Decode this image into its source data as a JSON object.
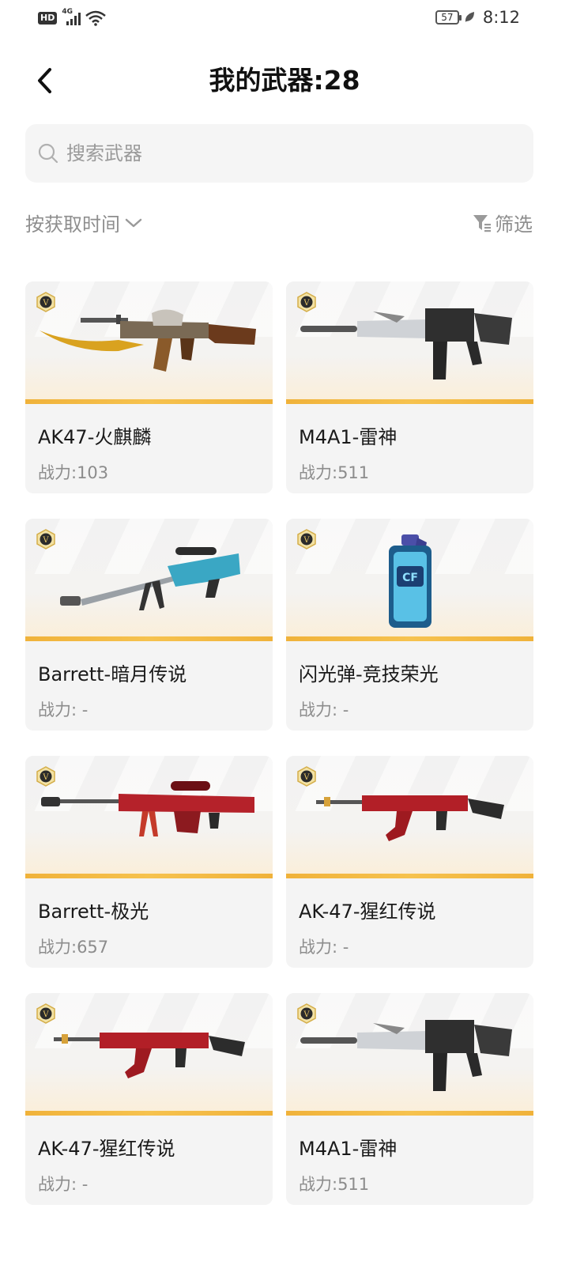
{
  "status_bar": {
    "hd": "HD",
    "network": "4G",
    "battery": "57",
    "time": "8:12"
  },
  "header": {
    "title": "我的武器:28"
  },
  "search": {
    "placeholder": "搜索武器"
  },
  "toolbar": {
    "sort_label": "按获取时间",
    "filter_label": "筛选"
  },
  "weapons": [
    {
      "name": "AK47-火麒麟",
      "power": "战力:103",
      "icon": "rifle-gold"
    },
    {
      "name": "M4A1-雷神",
      "power": "战力:511",
      "icon": "m4-silver"
    },
    {
      "name": "Barrett-暗月传说",
      "power": "战力: -",
      "icon": "sniper-cyan"
    },
    {
      "name": "闪光弹-竞技荣光",
      "power": "战力: -",
      "icon": "flashbang-blue"
    },
    {
      "name": "Barrett-极光",
      "power": "战力:657",
      "icon": "sniper-red"
    },
    {
      "name": "AK-47-猩红传说",
      "power": "战力: -",
      "icon": "rifle-red"
    },
    {
      "name": "AK-47-猩红传说",
      "power": "战力: -",
      "icon": "rifle-red"
    },
    {
      "name": "M4A1-雷神",
      "power": "战力:511",
      "icon": "m4-silver"
    }
  ],
  "colors": {
    "accent_strip": "#f0b23a",
    "card_bg": "#f4f4f4",
    "muted_text": "#8c8c8c"
  }
}
